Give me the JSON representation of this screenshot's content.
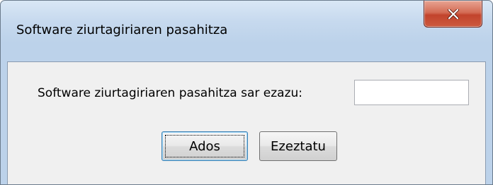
{
  "dialog": {
    "title": "Software ziurtagiriaren pasahitza",
    "close_label": "X"
  },
  "form": {
    "prompt_label": "Software ziurtagiriaren pasahitza sar ezazu:",
    "password_value": "",
    "password_placeholder": ""
  },
  "buttons": {
    "ok_label": "Ados",
    "cancel_label": "Ezeztatu"
  },
  "colors": {
    "close_button": "#c2432c",
    "dialog_frame": "#bcd2ea",
    "client_area": "#f0f0f0",
    "default_button_border": "#3c7fb1"
  }
}
